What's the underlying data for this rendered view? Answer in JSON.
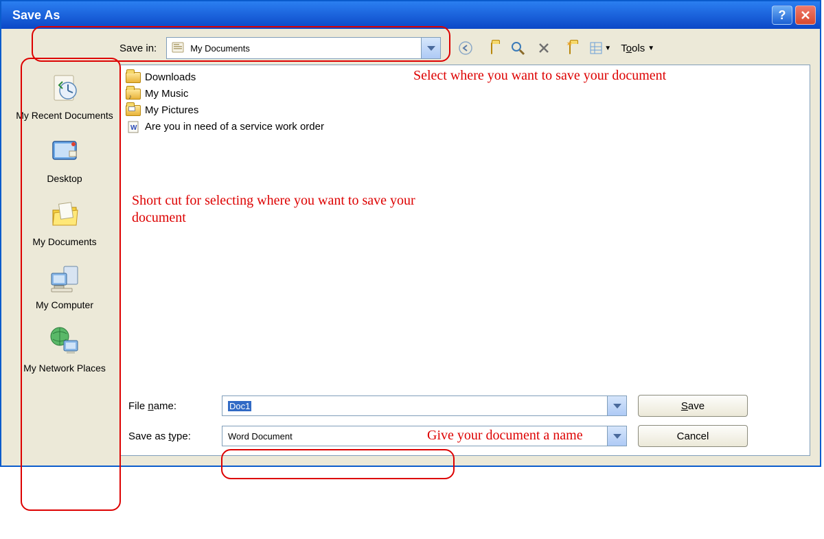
{
  "window": {
    "title": "Save As"
  },
  "savein": {
    "label": "Save in:",
    "value": "My Documents"
  },
  "toolbar": {
    "tools_label": "Tools"
  },
  "sidebar": {
    "items": [
      {
        "label": "My Recent Documents"
      },
      {
        "label": "Desktop"
      },
      {
        "label": "My Documents"
      },
      {
        "label": "My Computer"
      },
      {
        "label": "My Network Places"
      }
    ]
  },
  "files": [
    {
      "name": "Downloads",
      "kind": "folder"
    },
    {
      "name": "My Music",
      "kind": "folder-special"
    },
    {
      "name": "My Pictures",
      "kind": "folder-special"
    },
    {
      "name": "Are you in need of a service work order",
      "kind": "doc"
    }
  ],
  "filename": {
    "label": "File name:",
    "value": "Doc1"
  },
  "savetype": {
    "label": "Save as type:",
    "value": "Word Document"
  },
  "buttons": {
    "save": "Save",
    "cancel": "Cancel"
  },
  "annotations": {
    "a1": "Select where you want to save your document",
    "a2": "Short cut for selecting where you want to save your document",
    "a3": "Give your document a name"
  }
}
